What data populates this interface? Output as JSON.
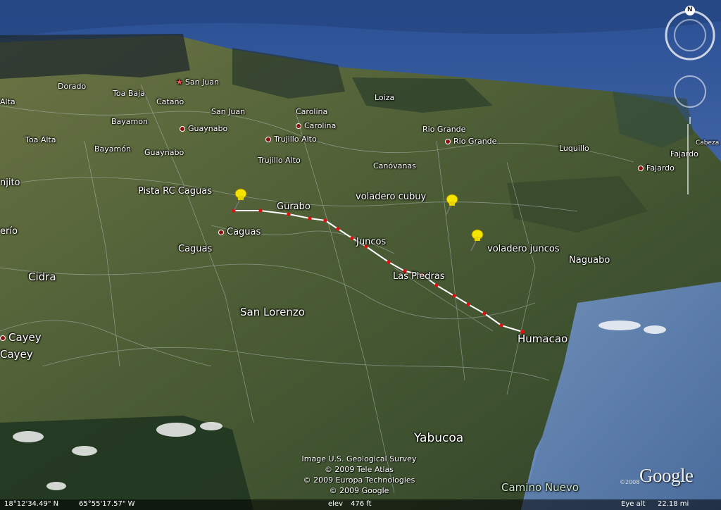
{
  "map": {
    "labels": {
      "san_juan_top": "San Juan",
      "dorado": "Dorado",
      "toa_baja": "Toa Baja",
      "alta": "Alta",
      "catano": "Cataño",
      "san_juan": "San Juan",
      "loiza": "Loiza",
      "carolina_1": "Carolina",
      "carolina_2": "Carolina",
      "bayamon_1": "Bayamon",
      "guaynabo_1": "Guaynabo",
      "toa_alta": "Toa Alta",
      "bayamon_2": "Bayamón",
      "guaynabo_2": "Guaynabo",
      "trujillo_alto_1": "Trujillo Alto",
      "trujillo_alto_2": "Trujillo Alto",
      "rio_grande_1": "Rio Grande",
      "rio_grande_2": "Rio Grande",
      "luquillo": "Luquillo",
      "cabeza": "Cabeza",
      "fajardo_1": "Fajardo",
      "fajardo_2": "Fajardo",
      "canovanas": "Canóvanas",
      "njito": "njito",
      "pista_rc": "Pista RC Caguas",
      "voladero_cubuy": "voladero cubuy",
      "gurabo": "Gurabo",
      "caguas_1": "Caguas",
      "caguas_2": "Caguas",
      "erio": "erío",
      "juncos": "Juncos",
      "voladero_juncos": "voladero juncos",
      "naguabo": "Naguabo",
      "cidra": "Cidra",
      "las_piedras": "Las Piedras",
      "san_lorenzo": "San Lorenzo",
      "cayey_1": "Cayey",
      "cayey_2": "Cayey",
      "humacao": "Humacao",
      "yabucoa": "Yabucoa",
      "camino_nuevo": "Camino Nuevo"
    },
    "compass_letter": "N",
    "credits": [
      "Image U.S. Geological Survey",
      "© 2009 Tele Atlas",
      "© 2009 Europa Technologies",
      "© 2009 Google"
    ],
    "logo": "Google",
    "logo_year": "©2008",
    "status": {
      "lat": "18°12'34.49\" N",
      "lon": "65°55'17.57\" W",
      "elev_label": "elev",
      "elev_value": "476 ft",
      "eye_label": "Eye alt",
      "eye_value": "22.18 mi"
    },
    "colors": {
      "ocean": "#3a5f9a",
      "land": "#56653a",
      "route_line": "#ffffff",
      "route_point": "#e01010",
      "pin": "#f5e400"
    },
    "icons": [
      "pushpin-icon",
      "compass-icon",
      "tilt-ring-icon",
      "zoom-slider-icon",
      "star-capital-icon",
      "town-dot-icon"
    ]
  }
}
